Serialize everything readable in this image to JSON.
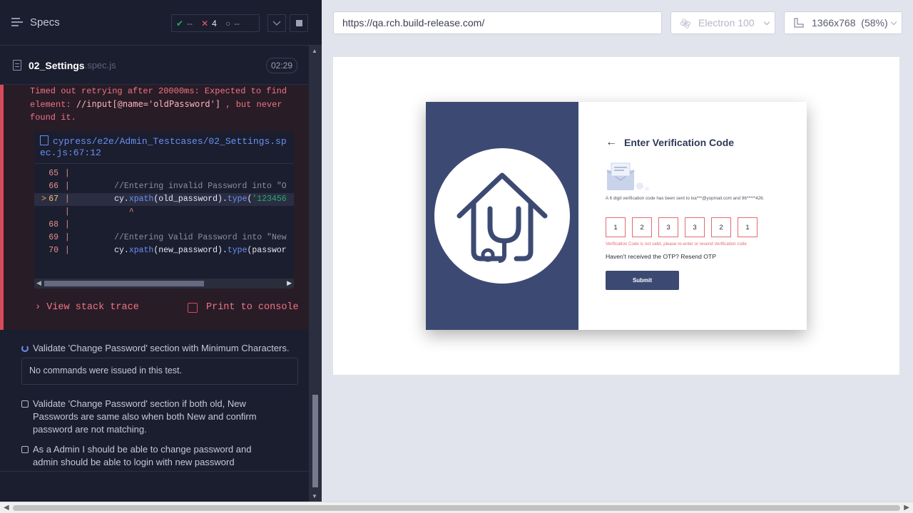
{
  "reporter": {
    "specs_label": "Specs",
    "stats": {
      "passed": "--",
      "failed": "4",
      "pending": "--"
    },
    "spec": {
      "name": "02_Settings",
      "ext": ".spec.js",
      "time": "02:29"
    },
    "error": {
      "line1": "Timed out retrying after 20000ms: Expected to find",
      "line2_pre": "element: ",
      "line2_code": "//input[@name='oldPassword']",
      "line2_post": ", but never",
      "line3": "found it.",
      "file_link_1": "cypress/e2e/Admin_Testcases/02_Settings.sp",
      "file_link_2": "ec.js:67:12",
      "code_lines": [
        {
          "num": "65",
          "text": ""
        },
        {
          "num": "66",
          "text": "        //Entering invalid Password into \"O"
        },
        {
          "num": "67",
          "pre": "        cy.",
          "fn1": "xpath",
          "mid1": "(old_password).",
          "fn2": "type",
          "mid2": "(",
          "str": "'123456"
        },
        {
          "num": "",
          "text": "           ^"
        },
        {
          "num": "68",
          "text": ""
        },
        {
          "num": "69",
          "text": "        //Entering Valid Password into \"New"
        },
        {
          "num": "70",
          "pre": "        cy.",
          "fn1": "xpath",
          "mid1": "(new_password).",
          "fn2": "type",
          "mid2": "(passwor"
        }
      ],
      "view_stack": "View stack trace",
      "print_console": "Print to console"
    },
    "tests": {
      "running": "Validate 'Change Password' section with Minimum Characters.",
      "no_commands": "No commands were issued in this test.",
      "pending_1": "Validate 'Change Password' section if both old, New Passwords are same also when both New and confirm password are not matching.",
      "pending_2": "As a Admin I should be able to change password and admin should be able to login with new password"
    }
  },
  "aut": {
    "url": "https://qa.rch.build-release.com/",
    "browser": "Electron 100",
    "viewport": "1366x768  (58%)",
    "page": {
      "heading": "Enter Verification Code",
      "message": "A 6 digit verification code has been sent to lxa***@yopmail.com and 96*****426.",
      "otp": [
        "1",
        "2",
        "3",
        "3",
        "2",
        "1"
      ],
      "otp_error": "Verification Code is not valid, please re-enter or resend Verification code",
      "resend": "Haven't received the OTP? Resend OTP",
      "submit": "Submit"
    }
  },
  "colors": {
    "accent_navy": "#3c4a73",
    "error": "#e36a73",
    "passed": "#1fa971",
    "failed": "#f15b6b"
  }
}
